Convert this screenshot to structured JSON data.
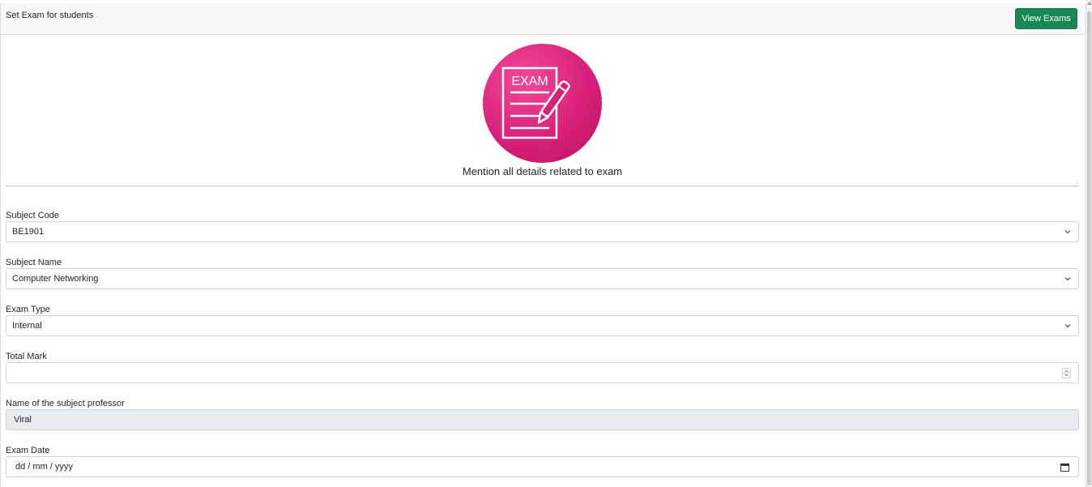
{
  "header": {
    "title": "Set Exam for students",
    "view_button": "View Exams"
  },
  "hero": {
    "icon_text": "EXAM",
    "caption": "Mention all details related to exam"
  },
  "form": {
    "subject_code": {
      "label": "Subject Code",
      "value": "BE1901"
    },
    "subject_name": {
      "label": "Subject Name",
      "value": "Computer Networking"
    },
    "exam_type": {
      "label": "Exam Type",
      "value": "Internal"
    },
    "total_mark": {
      "label": "Total Mark",
      "value": ""
    },
    "professor": {
      "label": "Name of the subject professor",
      "value": "Viral"
    },
    "exam_date": {
      "label": "Exam Date",
      "placeholder": "dd / mm / yyyy"
    }
  },
  "colors": {
    "primary_button": "#198754",
    "exam_icon": "#d8207a"
  },
  "icons": [
    "exam-paper-icon",
    "pencil-icon",
    "chevron-down-icon",
    "number-spinner-icon",
    "calendar-icon"
  ]
}
